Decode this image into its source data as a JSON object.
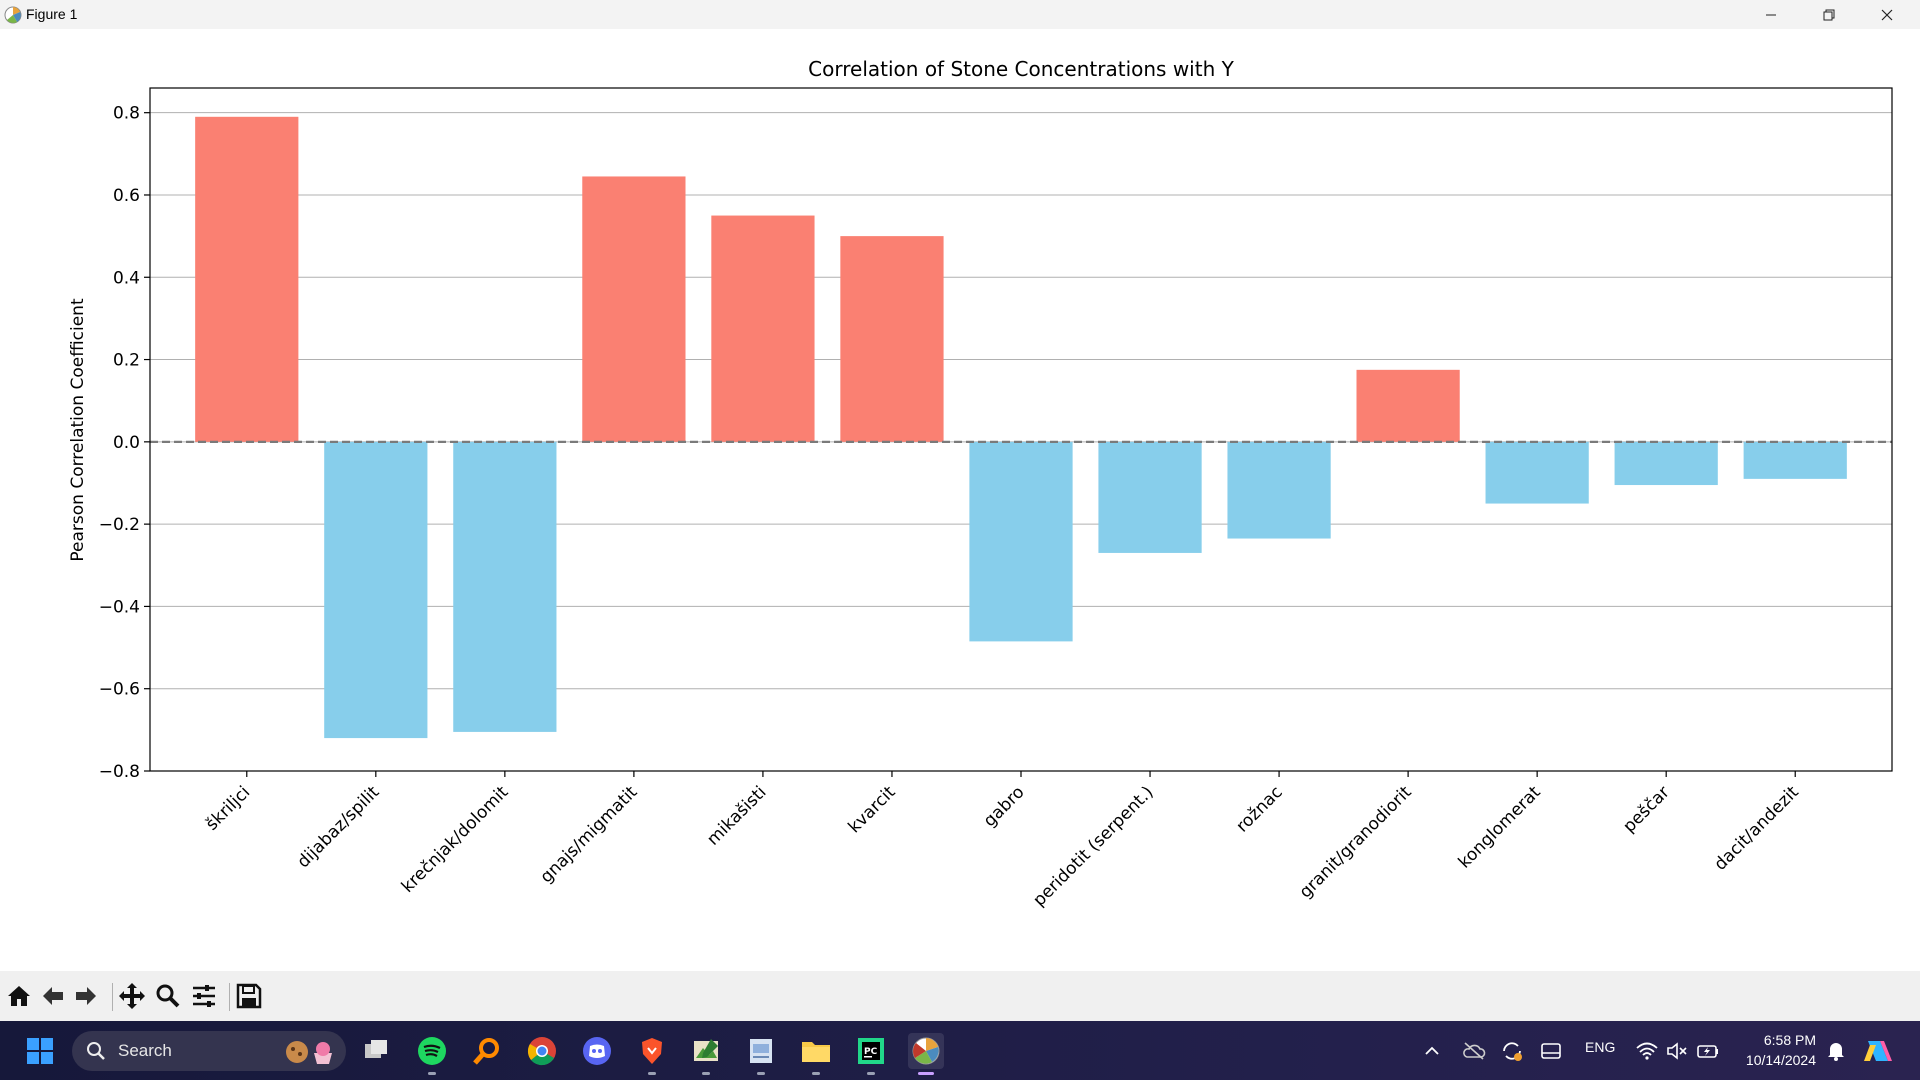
{
  "window": {
    "title": "Figure 1"
  },
  "chart_data": {
    "type": "bar",
    "title": "Correlation of Stone Concentrations with Y",
    "xlabel": "",
    "ylabel": "Pearson Correlation Coefficient",
    "ylim": [
      -0.8,
      0.86
    ],
    "yticks": [
      0.8,
      0.6,
      0.4,
      0.2,
      0.0,
      -0.2,
      -0.4,
      -0.6,
      -0.8
    ],
    "ytick_labels": [
      "0.8",
      "0.6",
      "0.4",
      "0.2",
      "0.0",
      "−0.2",
      "−0.4",
      "−0.6",
      "−0.8"
    ],
    "grid": "horizontal",
    "reference_line": 0.0,
    "categories": [
      "škriljci",
      "dijabaz/spilit",
      "krečnjak/dolomit",
      "gnajs/migmatit",
      "mikašisti",
      "kvarcit",
      "gabro",
      "peridotit (serpent.)",
      "rožnac",
      "granit/granodiorit",
      "konglomerat",
      "peščar",
      "dacit/andezit"
    ],
    "values": [
      0.79,
      -0.72,
      -0.705,
      0.645,
      0.55,
      0.5,
      -0.485,
      -0.27,
      -0.235,
      0.175,
      -0.15,
      -0.105,
      -0.09
    ],
    "colors": {
      "positive": "#fa8072",
      "negative": "#87ceeb"
    }
  },
  "toolbar": {
    "buttons": [
      "home-icon",
      "back-arrow-icon",
      "forward-arrow-icon",
      "pan-icon",
      "zoom-icon",
      "configure-subplots-icon",
      "save-icon"
    ]
  },
  "taskbar": {
    "search_placeholder": "Search",
    "language": "ENG",
    "time": "6:58 PM",
    "date": "10/14/2024"
  }
}
